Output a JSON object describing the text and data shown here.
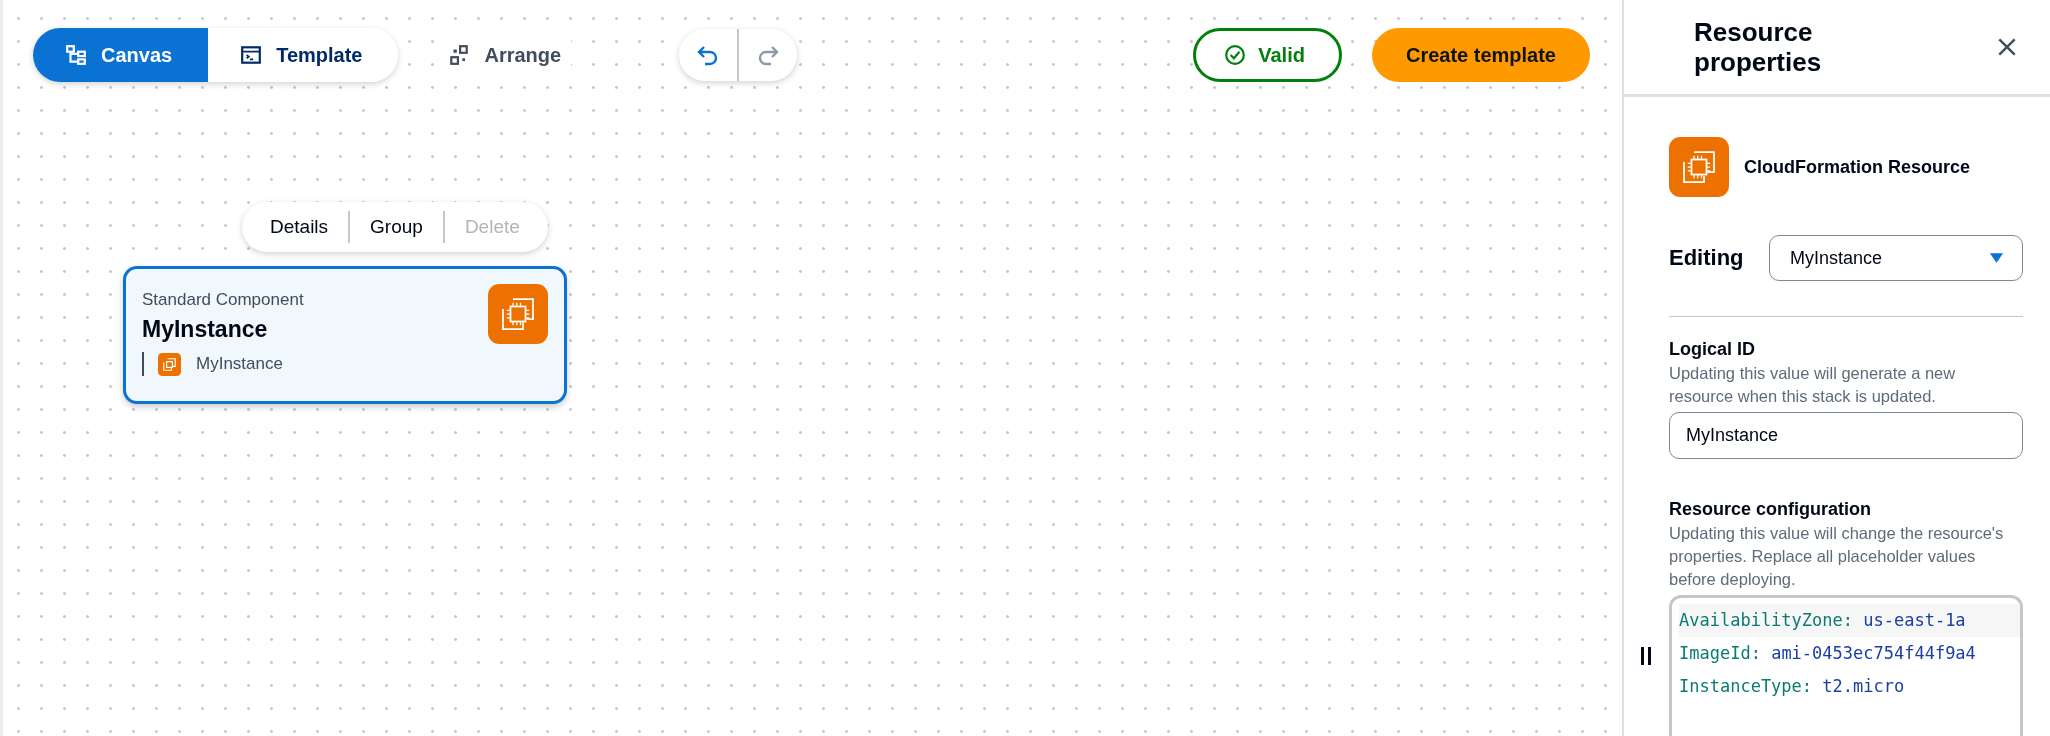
{
  "toolbar": {
    "view_tabs": [
      {
        "label": "Canvas",
        "kind": "canvas",
        "selected": true
      },
      {
        "label": "Template",
        "kind": "template",
        "selected": false
      }
    ],
    "arrange": {
      "label": "Arrange"
    },
    "history": [
      {
        "kind": "undo",
        "disabled": false
      },
      {
        "kind": "redo",
        "disabled": true
      }
    ],
    "validation": {
      "label": "Valid",
      "valid": true
    },
    "create_button": {
      "label": "Create template"
    }
  },
  "canvas": {
    "context_menu": [
      {
        "label": "Details",
        "disabled": false
      },
      {
        "label": "Group",
        "disabled": false
      },
      {
        "label": "Delete",
        "disabled": true
      }
    ],
    "node": {
      "type_label": "Standard Component",
      "title": "MyInstance",
      "selected": true,
      "resources": [
        {
          "label": "MyInstance"
        }
      ]
    }
  },
  "panel": {
    "title": "Resource properties",
    "resource_type": "CloudFormation Resource",
    "editing": {
      "label": "Editing",
      "value": "MyInstance"
    },
    "logical_id": {
      "label": "Logical ID",
      "description": "Updating this value will generate a new resource when this stack is updated.",
      "value": "MyInstance"
    },
    "configuration": {
      "label": "Resource configuration",
      "description": "Updating this value will change the resource's properties. Replace all placeholder values before deploying.",
      "code_lines": [
        {
          "key": "AvailabilityZone:",
          "value": "us-east-1a"
        },
        {
          "key": "ImageId:",
          "value": "ami-0453ec754f44f9a4"
        },
        {
          "key": "InstanceType:",
          "value": "t2.micro"
        }
      ]
    }
  }
}
